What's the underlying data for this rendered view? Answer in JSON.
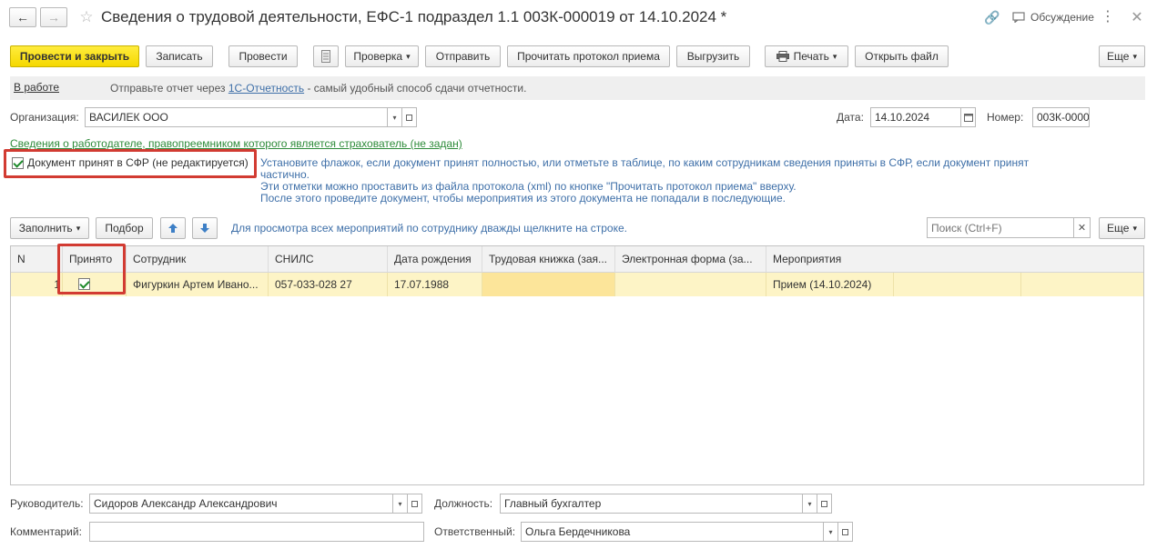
{
  "window": {
    "title": "Сведения о трудовой деятельности, ЕФС-1 подраздел 1.1 003К-000019 от 14.10.2024 *",
    "discussion_label": "Обсуждение"
  },
  "toolbar": {
    "post_close": "Провести и закрыть",
    "save": "Записать",
    "post": "Провести",
    "check": "Проверка",
    "send": "Отправить",
    "read_protocol": "Прочитать протокол приема",
    "export": "Выгрузить",
    "print": "Печать",
    "open_file": "Открыть файл",
    "more": "Еще"
  },
  "status_bar": {
    "status_link": "В работе",
    "text_before": "Отправьте отчет через",
    "link": "1С-Отчетность",
    "text_after": "- самый удобный способ сдачи отчетности."
  },
  "form": {
    "org_label": "Организация:",
    "org_value": "ВАСИЛЕК ООО",
    "date_label": "Дата:",
    "date_value": "14.10.2024",
    "number_label": "Номер:",
    "number_value": "003К-0000",
    "employer_link": "Сведения о работодателе, правопреемником которого является страхователь (не задан)",
    "accepted_label": "Документ принят в СФР (не редактируется)",
    "hint_line1": "Установите флажок, если документ принят полностью, или отметьте в таблице, по каким сотрудникам сведения приняты в СФР, если документ принят",
    "hint_line2": "частично.",
    "hint_line3": "Эти отметки можно проставить из файла протокола (xml) по кнопке \"Прочитать протокол приема\" вверху.",
    "hint_line4": "После этого проведите документ, чтобы мероприятия из этого документа не попадали в последующие."
  },
  "table_toolbar": {
    "fill": "Заполнить",
    "select": "Подбор",
    "hint": "Для просмотра всех мероприятий по сотруднику дважды щелкните на строке.",
    "search_placeholder": "Поиск (Ctrl+F)",
    "more": "Еще"
  },
  "table": {
    "headers": [
      "N",
      "Принято",
      "Сотрудник",
      "СНИЛС",
      "Дата рождения",
      "Трудовая книжка (зая...",
      "Электронная форма (за...",
      "Мероприятия"
    ],
    "rows": [
      {
        "n": "1",
        "accepted": true,
        "employee": "Фигуркин Артем Ивано...",
        "snils": "057-033-028 27",
        "birth_date": "17.07.1988",
        "work_book": "",
        "electronic_form": "",
        "events": "Прием (14.10.2024)"
      }
    ]
  },
  "footer": {
    "head_label": "Руководитель:",
    "head_value": "Сидоров Александр Александрович",
    "position_label": "Должность:",
    "position_value": "Главный бухгалтер",
    "comment_label": "Комментарий:",
    "comment_value": "",
    "responsible_label": "Ответственный:",
    "responsible_value": "Ольга Бердечникова"
  },
  "colors": {
    "accent_yellow": "#f5d800",
    "row_highlight": "#fdf4c6",
    "link_green": "#2e8b3a",
    "link_blue": "#3e6fa8",
    "highlight_box": "#d23b32"
  }
}
